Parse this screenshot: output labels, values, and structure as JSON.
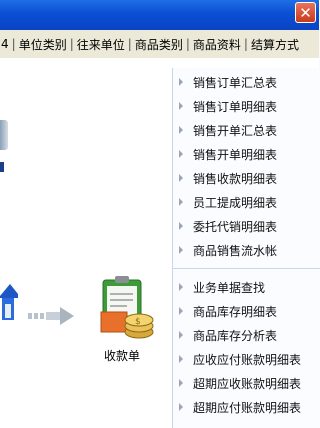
{
  "window": {
    "close_label": "✕"
  },
  "toolbar": {
    "items": [
      "4",
      "单位类别",
      "往来单位",
      "商品类别",
      "商品资料",
      "结算方式"
    ]
  },
  "flow": {
    "receipt_label": "收款单"
  },
  "right_menu": {
    "group1": [
      "销售订单汇总表",
      "销售订单明细表",
      "销售开单汇总表",
      "销售开单明细表",
      "销售收款明细表",
      "员工提成明细表",
      "委托代销明细表",
      "商品销售流水帐"
    ],
    "group2": [
      "业务单据查找",
      "商品库存明细表",
      "商品库存分析表",
      "应收应付账款明细表",
      "超期应收账款明细表",
      "超期应付账款明细表"
    ]
  },
  "colors": {
    "titlebar": "#0a4fd4",
    "close": "#d2462a",
    "panel_border": "#c9d6e8"
  }
}
